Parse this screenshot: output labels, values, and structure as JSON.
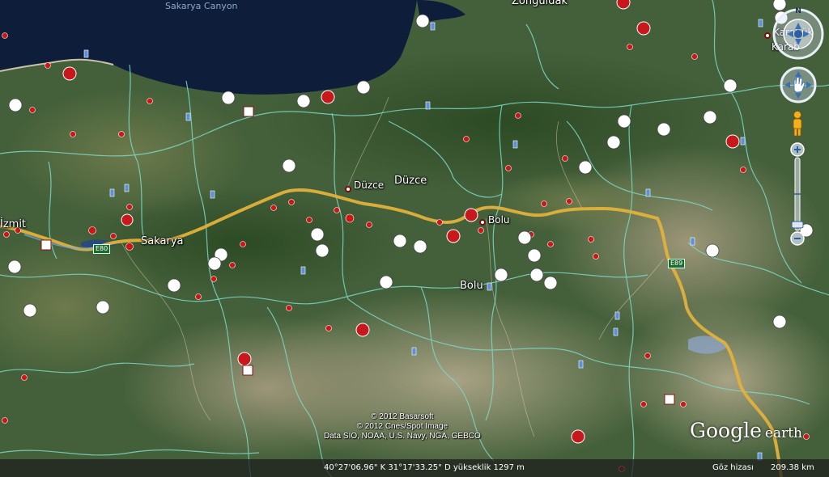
{
  "places": {
    "izmit": "İzmit",
    "sakarya": "Sakarya",
    "duzce_city": "Düzce",
    "duzce_region": "Düzce",
    "bolu_city": "Bolu",
    "bolu_region": "Bolu",
    "zonguldak": "Zonguldak",
    "karabuk_city": "Karabük",
    "karabuk_short": "Karab",
    "sakarya_canyon": "Sakarya Canyon"
  },
  "road_shields": {
    "e80": "E80",
    "e89": "E89"
  },
  "credits": {
    "line1": "© 2012 Basarsoft",
    "line2": "© 2012 Cnes/Spot Image",
    "line3": "Data SIO, NOAA, U.S. Navy, NGA, GEBCO"
  },
  "status_bar": {
    "coordinates": "40°27'06.96\" K   31°17'33.25\" D   yükseklik  1297 m",
    "eye_altitude_label": "Göz hizası",
    "eye_altitude_value": "209.38 km"
  },
  "brand": {
    "google": "Google",
    "earth": "earth"
  },
  "controls": {
    "compass_north": "N"
  },
  "colors": {
    "sea": "#0d1d3a",
    "land_green": "#3d5a30",
    "land_dry": "#8a8668",
    "route": "#e0b13c",
    "borders": "#7dd8c6",
    "poi_red": "#c8181c"
  },
  "icons": [
    "360-panorama-icon",
    "photo-icon",
    "hiker-icon",
    "cyclist-icon",
    "car-icon",
    "info-icon",
    "pegman-icon"
  ]
}
